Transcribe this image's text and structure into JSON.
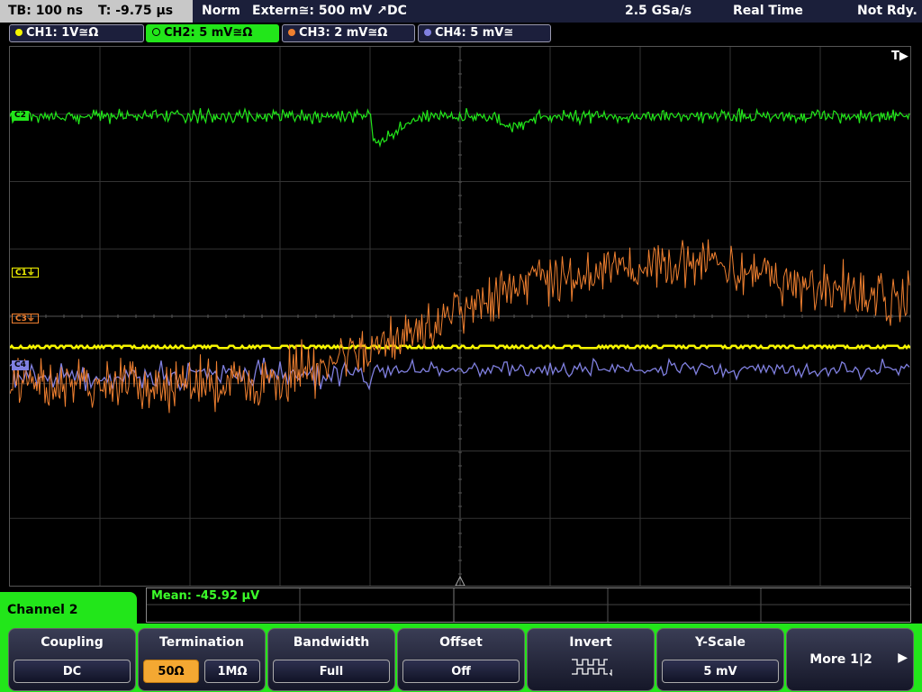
{
  "status": {
    "timebase": "TB: 100 ns",
    "trigger_time": "T: -9.75 µs",
    "mode": "Norm",
    "trigger_source": "Extern≅: 500 mV ↗DC",
    "sample_rate": "2.5 GSa/s",
    "acq_mode": "Real Time",
    "state": "Not Rdy."
  },
  "channels": [
    {
      "label": "CH1: 1V≅Ω",
      "color": "#f5f500"
    },
    {
      "label": "CH2: 5 mV≅Ω",
      "color": "#22e61a"
    },
    {
      "label": "CH3: 2 mV≅Ω",
      "color": "#f08030"
    },
    {
      "label": "CH4: 5 mV≅",
      "color": "#8080e0"
    }
  ],
  "markers": {
    "c1": "C1",
    "c2": "C2",
    "c3": "C3",
    "c4": "C4",
    "trigger": "T"
  },
  "measurement": {
    "text": "Mean: -45.92 µV"
  },
  "menu_title": "Channel 2",
  "softkeys": {
    "coupling": {
      "title": "Coupling",
      "value": "DC"
    },
    "termination": {
      "title": "Termination",
      "option1": "50Ω",
      "option2": "1MΩ",
      "selected": "50Ω"
    },
    "bandwidth": {
      "title": "Bandwidth",
      "value": "Full"
    },
    "offset": {
      "title": "Offset",
      "value": "Off"
    },
    "invert": {
      "title": "Invert"
    },
    "yscale": {
      "title": "Y-Scale",
      "value": "5 mV"
    },
    "more": {
      "label": "More 1|2"
    }
  },
  "colors": {
    "accent_green": "#22e61a",
    "ch1": "#f5f500",
    "ch2": "#22e61a",
    "ch3": "#f08030",
    "ch4": "#8080e0",
    "selected_option": "#f4a832"
  }
}
